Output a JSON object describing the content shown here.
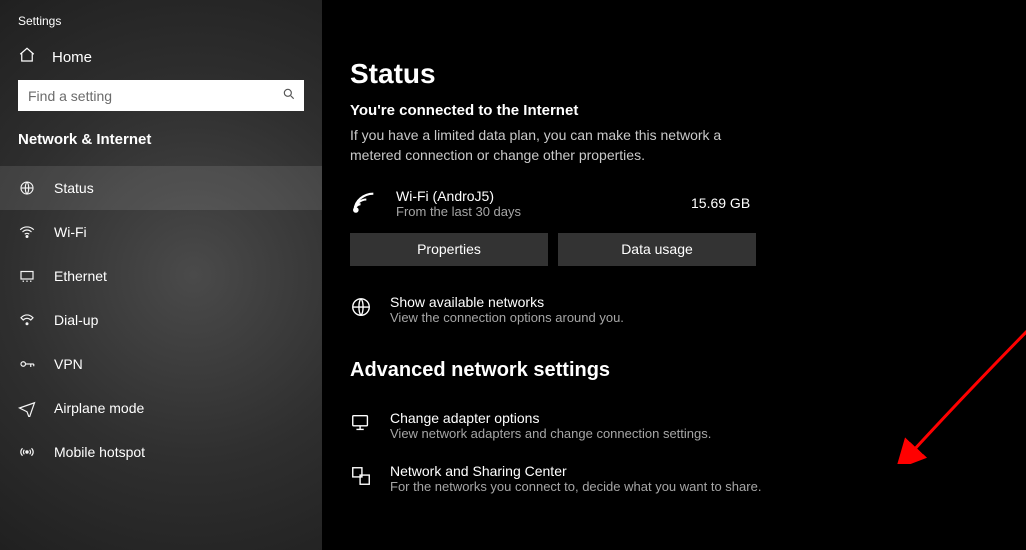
{
  "app_title": "Settings",
  "home_label": "Home",
  "search_placeholder": "Find a setting",
  "section": "Network & Internet",
  "nav": {
    "status": "Status",
    "wifi": "Wi-Fi",
    "ethernet": "Ethernet",
    "dialup": "Dial-up",
    "vpn": "VPN",
    "airplane": "Airplane mode",
    "hotspot": "Mobile hotspot"
  },
  "page": {
    "title": "Status",
    "subhead": "You're connected to the Internet",
    "body": "If you have a limited data plan, you can make this network a metered connection or change other properties."
  },
  "connection": {
    "name": "Wi-Fi (AndroJ5)",
    "sub": "From the last 30 days",
    "usage": "15.69 GB"
  },
  "buttons": {
    "properties": "Properties",
    "data_usage": "Data usage"
  },
  "links": {
    "available": {
      "title": "Show available networks",
      "sub": "View the connection options around you."
    },
    "adv_heading": "Advanced network settings",
    "adapter": {
      "title": "Change adapter options",
      "sub": "View network adapters and change connection settings."
    },
    "sharing": {
      "title": "Network and Sharing Center",
      "sub": "For the networks you connect to, decide what you want to share."
    }
  }
}
